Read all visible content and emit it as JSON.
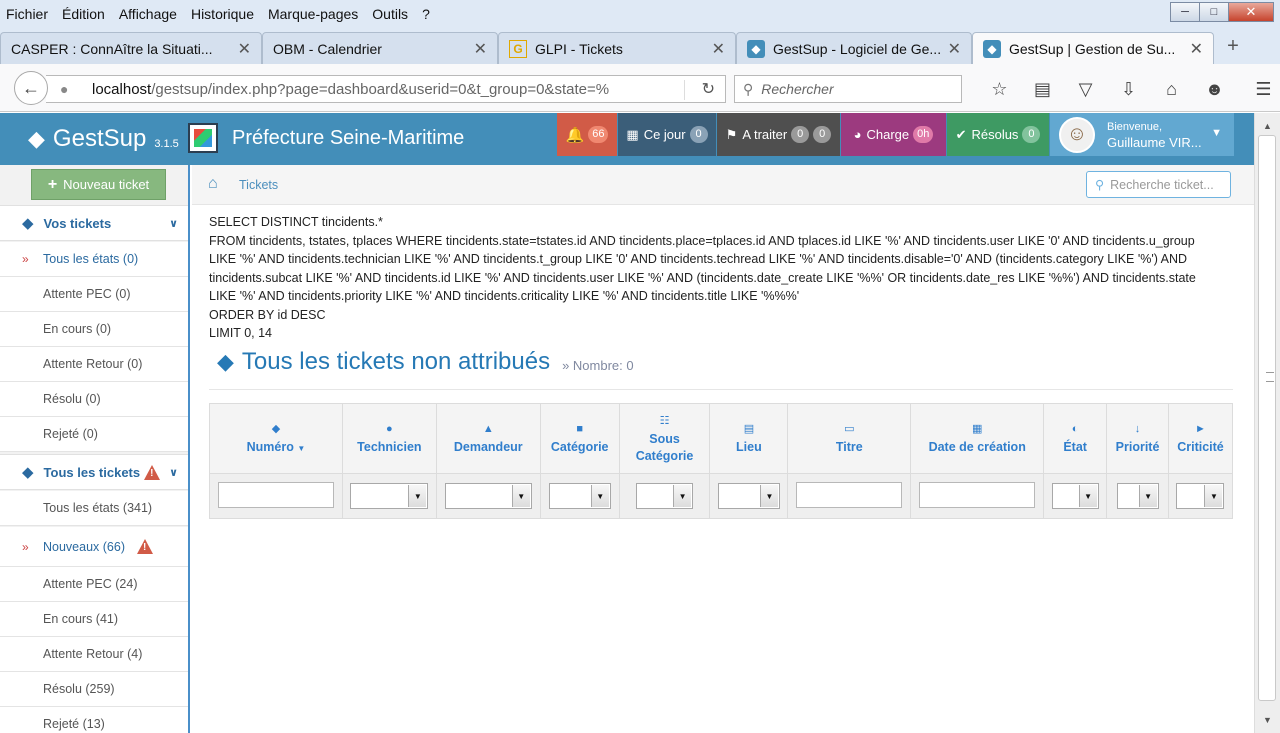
{
  "browser": {
    "menu": [
      "Fichier",
      "Édition",
      "Affichage",
      "Historique",
      "Marque-pages",
      "Outils",
      "?"
    ],
    "tabs": [
      {
        "label": "CASPER : ConnAître la Situati..."
      },
      {
        "label": "OBM - Calendrier"
      },
      {
        "label": "GLPI - Tickets"
      },
      {
        "label": "GestSup - Logiciel de Ge..."
      },
      {
        "label": "GestSup | Gestion de Su..."
      }
    ],
    "url_host": "localhost",
    "url_path": "/gestsup/index.php?page=dashboard&userid=0&t_group=0&state=%",
    "search_placeholder": "Rechercher"
  },
  "app": {
    "name": "GestSup",
    "version": "3.1.5",
    "organization": "Préfecture Seine-Maritime",
    "header_buttons": [
      {
        "label": "",
        "badges": [
          "66"
        ],
        "color": "#d15b47"
      },
      {
        "label": "Ce jour",
        "badges": [
          "0"
        ],
        "color": "#3b5e79"
      },
      {
        "label": "A traiter",
        "badges": [
          "0",
          "0"
        ],
        "color": "#4f4f4f"
      },
      {
        "label": "Charge",
        "badges": [
          "0h"
        ],
        "color": "#9c3a7f"
      },
      {
        "label": "Résolus",
        "badges": [
          "0"
        ],
        "color": "#3e9a63"
      }
    ],
    "user_welcome": "Bienvenue,",
    "user_name": "Guillaume VIR..."
  },
  "sidebar": {
    "new_ticket": "Nouveau ticket",
    "group_mine": "Vos tickets",
    "mine_items": [
      "Tous les états (0)",
      "Attente PEC (0)",
      "En cours (0)",
      "Attente Retour (0)",
      "Résolu (0)",
      "Rejeté (0)"
    ],
    "group_all": "Tous les tickets",
    "all_items": [
      "Tous les états (341)",
      "Nouveaux (66)",
      "Attente PEC (24)",
      "En cours (41)",
      "Attente Retour (4)",
      "Résolu (259)",
      "Rejeté (13)"
    ]
  },
  "main": {
    "breadcrumb": "Tickets",
    "search_placeholder": "Recherche ticket...",
    "sql": [
      "SELECT DISTINCT tincidents.*",
      "FROM tincidents, tstates, tplaces WHERE tincidents.state=tstates.id AND tincidents.place=tplaces.id AND tplaces.id LIKE '%' AND tincidents.user LIKE '0' AND tincidents.u_group LIKE '%' AND tincidents.technician LIKE '%' AND tincidents.t_group LIKE '0' AND tincidents.techread LIKE '%' AND tincidents.disable='0' AND (tincidents.category LIKE '%') AND tincidents.subcat LIKE '%' AND tincidents.id LIKE '%' AND tincidents.user LIKE '%' AND (tincidents.date_create LIKE '%%' OR tincidents.date_res LIKE '%%') AND tincidents.state LIKE '%' AND tincidents.priority LIKE '%' AND tincidents.criticality LIKE '%' AND tincidents.title LIKE '%%%'",
      "ORDER BY id DESC",
      "LIMIT 0, 14"
    ],
    "title": "Tous les tickets non attribués",
    "count_label": "» Nombre: 0",
    "columns": [
      "Numéro",
      "Technicien",
      "Demandeur",
      "Catégorie",
      "Sous Catégorie",
      "Lieu",
      "Titre",
      "Date de création",
      "État",
      "Priorité",
      "Criticité"
    ]
  }
}
